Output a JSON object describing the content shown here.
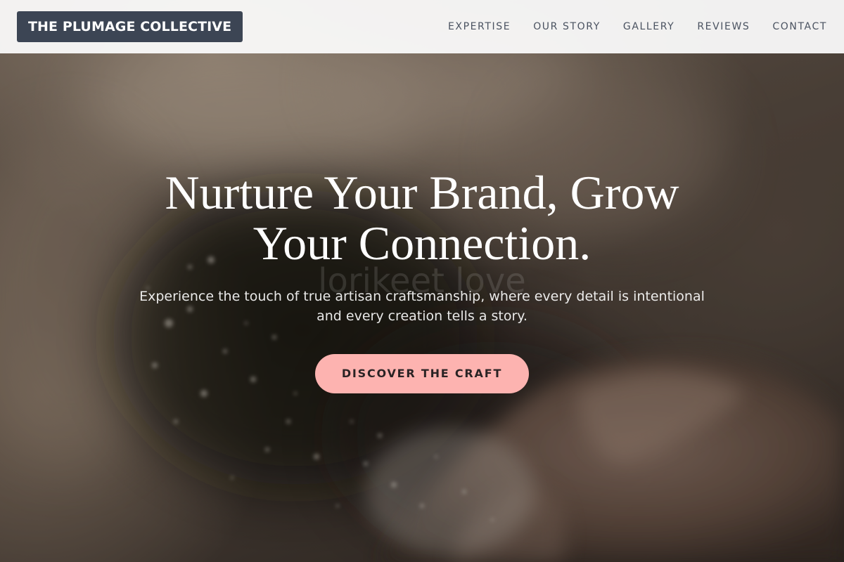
{
  "brand": {
    "name": "THE PLUMAGE COLLECTIVE"
  },
  "nav": {
    "items": [
      {
        "label": "EXPERTISE"
      },
      {
        "label": "OUR STORY"
      },
      {
        "label": "GALLERY"
      },
      {
        "label": "REVIEWS"
      },
      {
        "label": "CONTACT"
      }
    ]
  },
  "hero": {
    "headline_line1": "Nurture Your Brand, Grow",
    "headline_line2": "Your Connection.",
    "watermark": "lorikeet love",
    "subtext_line1": "Experience the touch of true artisan craftsmanship, where every detail is intentional",
    "subtext_line2": "and every creation tells a story.",
    "cta_label": "DISCOVER THE CRAFT",
    "background_description_icon": "flour-dusted-hands-photo"
  },
  "colors": {
    "logo_bg": "#3c4554",
    "header_bg": "#fafafa",
    "nav_text": "#4a5260",
    "cta_bg": "#fdb3b0",
    "cta_text": "#2a2324",
    "headline": "#ffffff"
  }
}
